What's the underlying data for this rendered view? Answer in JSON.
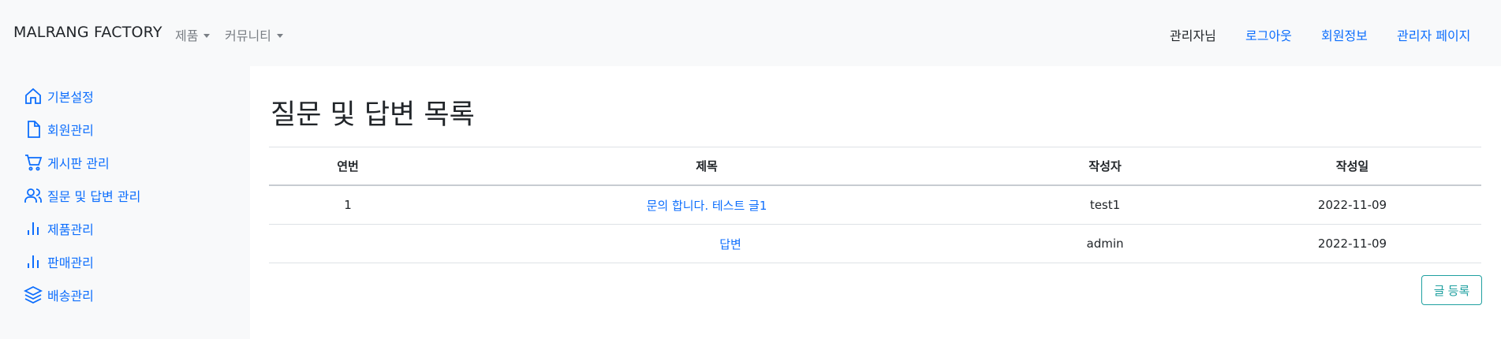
{
  "navbar": {
    "brand": "MALRANG FACTORY",
    "products_menu": "제품",
    "community_menu": "커뮤니티",
    "admin_greeting": "관리자님",
    "logout": "로그아웃",
    "member_info": "회원정보",
    "admin_page": "관리자 페이지"
  },
  "sidebar": {
    "items": [
      {
        "label": "기본설정",
        "icon": "home-icon"
      },
      {
        "label": "회원관리",
        "icon": "file-icon"
      },
      {
        "label": "게시판 관리",
        "icon": "cart-icon"
      },
      {
        "label": "질문 및 답변 관리",
        "icon": "users-icon"
      },
      {
        "label": "제품관리",
        "icon": "bar-chart-icon"
      },
      {
        "label": "판매관리",
        "icon": "bar-chart-icon"
      },
      {
        "label": "배송관리",
        "icon": "layers-icon"
      }
    ]
  },
  "main": {
    "title": "질문 및 답변 목록",
    "table": {
      "headers": [
        "연번",
        "제목",
        "작성자",
        "작성일"
      ],
      "rows": [
        {
          "no": "1",
          "title": "문의 합니다. 테스트 글1",
          "author": "test1",
          "date": "2022-11-09"
        },
        {
          "no": "",
          "title": "답변",
          "author": "admin",
          "date": "2022-11-09"
        }
      ]
    },
    "write_button": "글 등록"
  },
  "colors": {
    "link": "#0d6efd",
    "sidebar_bg": "#f8f9fa",
    "write_button": "#20a0a0"
  }
}
